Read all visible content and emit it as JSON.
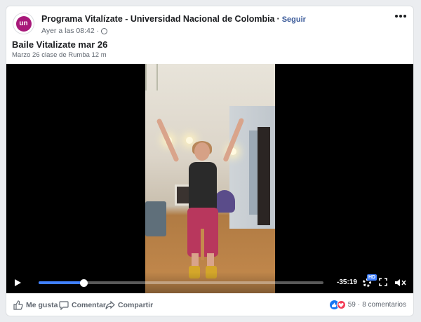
{
  "post": {
    "page_name": "Programa Vitalízate - Universidad Nacional de Colombia",
    "separator": "·",
    "follow_label": "Seguir",
    "timestamp": "Ayer a las 08:42 ·",
    "avatar_text": "un",
    "title": "Baile Vitalizate mar 26",
    "subtitle": "Marzo 26 clase de Rumba 12 m"
  },
  "video": {
    "remaining_time": "-35:19",
    "quality_badge": "HD",
    "progress_fraction": 0.16
  },
  "actions": {
    "like_label": "Me gusta",
    "comment_label": "Comentar",
    "share_label": "Compartir"
  },
  "reactions": {
    "count": "59",
    "separator": "·",
    "comments": "8 comentarios"
  },
  "colors": {
    "accent": "#4080ff",
    "link": "#385898",
    "avatar": "#a8197a",
    "like": "#1877f2",
    "love": "#f33e58"
  }
}
